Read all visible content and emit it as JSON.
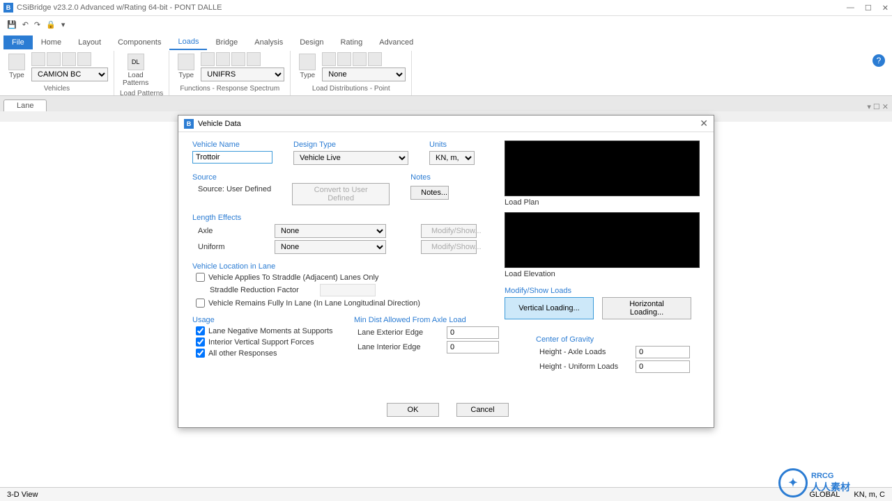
{
  "app": {
    "title": "CSiBridge v23.2.0 Advanced w/Rating 64-bit - PONT DALLE"
  },
  "menu": {
    "file": "File",
    "items": [
      "Home",
      "Layout",
      "Components",
      "Loads",
      "Bridge",
      "Analysis",
      "Design",
      "Rating",
      "Advanced"
    ],
    "active": "Loads"
  },
  "ribbon": {
    "type_label": "Type",
    "vehicles_combo": "CAMION BC",
    "vehicles_group": "Vehicles",
    "dl_label": "DL",
    "load_patterns_btn": "Load\nPatterns",
    "load_patterns_group": "Load Patterns",
    "functions_combo": "UNIFRS",
    "functions_group": "Functions - Response Spectrum",
    "dist_combo": "None",
    "dist_group": "Load Distributions - Point"
  },
  "tab": {
    "name": "Lane"
  },
  "dialog": {
    "title": "Vehicle Data",
    "vehicle_name_label": "Vehicle Name",
    "vehicle_name_value": "Trottoir",
    "design_type_label": "Design Type",
    "design_type_value": "Vehicle Live",
    "units_label": "Units",
    "units_value": "KN, m, C",
    "source_label": "Source",
    "source_value": "Source: User Defined",
    "convert_btn": "Convert to User Defined",
    "notes_label": "Notes",
    "notes_btn": "Notes...",
    "length_effects_label": "Length Effects",
    "axle_label": "Axle",
    "axle_value": "None",
    "uniform_label": "Uniform",
    "uniform_value": "None",
    "modify_show_btn": "Modify/Show...",
    "location_label": "Vehicle Location in Lane",
    "straddle_check": "Vehicle Applies To Straddle (Adjacent) Lanes Only",
    "straddle_factor_label": "Straddle Reduction Factor",
    "remains_check": "Vehicle Remains Fully In Lane (In Lane Longitudinal Direction)",
    "usage_label": "Usage",
    "usage_neg": "Lane Negative Moments at Supports",
    "usage_int": "Interior Vertical Support Forces",
    "usage_other": "All other Responses",
    "min_dist_label": "Min Dist Allowed From Axle Load",
    "lane_ext_label": "Lane Exterior Edge",
    "lane_ext_value": "0",
    "lane_int_label": "Lane Interior Edge",
    "lane_int_value": "0",
    "cog_label": "Center of Gravity",
    "height_axle_label": "Height - Axle Loads",
    "height_axle_value": "0",
    "height_uni_label": "Height - Uniform Loads",
    "height_uni_value": "0",
    "load_plan_label": "Load Plan",
    "load_elev_label": "Load Elevation",
    "modify_loads_label": "Modify/Show Loads",
    "vert_loading_btn": "Vertical Loading...",
    "horz_loading_btn": "Horizontal Loading...",
    "ok_btn": "OK",
    "cancel_btn": "Cancel"
  },
  "status": {
    "left": "3-D View",
    "global": "GLOBAL",
    "units": "KN, m, C"
  },
  "watermark": {
    "text": "RRCG",
    "sub": "人人素材"
  }
}
